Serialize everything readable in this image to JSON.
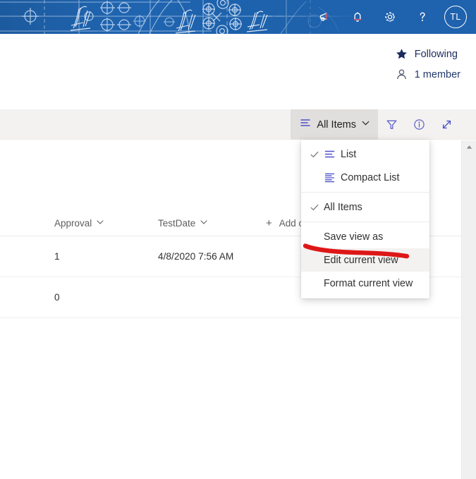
{
  "suite_bar": {
    "background_color": "#1f62ad",
    "theme_image": "blueprint-technical-drawing",
    "actions": [
      {
        "name": "megaphone-icon",
        "label": "Announcements"
      },
      {
        "name": "bell-icon",
        "label": "Notifications"
      },
      {
        "name": "gear-icon",
        "label": "Settings"
      },
      {
        "name": "question-icon",
        "label": "Help"
      }
    ],
    "avatar": {
      "initials": "TL",
      "label": "Account manager"
    }
  },
  "site_header": {
    "following": {
      "label": "Following",
      "icon": "star-filled-icon",
      "color": "#1b2a5e"
    },
    "members": {
      "label": "1 member",
      "icon": "person-icon",
      "color": "#21386e"
    }
  },
  "toolbar": {
    "background_color": "#f3f2f1",
    "view_switcher": {
      "label": "All Items",
      "icon": "list-icon",
      "chevron": "chevron-down-icon",
      "active": true,
      "active_color": "#e1dfdd"
    },
    "icons": [
      {
        "name": "filter-icon",
        "label": "Filter",
        "color": "#6264c7"
      },
      {
        "name": "info-icon",
        "label": "Details",
        "color": "#6264c7"
      },
      {
        "name": "expand-icon",
        "label": "Expand",
        "color": "#4f52c9"
      }
    ]
  },
  "view_menu": {
    "accent_color": "#4f52c9",
    "hovered_item": "Edit current view",
    "items": [
      {
        "label": "List",
        "checked": true,
        "icon": "list-icon",
        "group": 1
      },
      {
        "label": "Compact List",
        "checked": false,
        "icon": "compact-list-icon",
        "group": 1
      },
      {
        "label": "All Items",
        "checked": true,
        "icon": "",
        "group": 2
      },
      {
        "label": "Save view as",
        "checked": false,
        "icon": "",
        "group": 3
      },
      {
        "label": "Edit current view",
        "checked": false,
        "icon": "",
        "group": 3
      },
      {
        "label": "Format current view",
        "checked": false,
        "icon": "",
        "group": 3
      }
    ]
  },
  "grid": {
    "columns": [
      {
        "label": "Approval",
        "sort_icon": "chevron-down-icon"
      },
      {
        "label": "TestDate",
        "sort_icon": "chevron-down-icon"
      },
      {
        "label": "Add co",
        "full_label": "Add column",
        "icon": "plus-icon",
        "truncated": true
      }
    ],
    "rows": [
      {
        "approval": "1",
        "testdate": "4/8/2020 7:56 AM"
      },
      {
        "approval": "0",
        "testdate": ""
      }
    ]
  },
  "scrollbar": {
    "track_color": "#f0f0f0",
    "up_arrow": "caret-up-icon"
  },
  "annotation": {
    "type": "freehand-underline-stroke",
    "color": "#e01b1b",
    "target": "Edit current view"
  }
}
